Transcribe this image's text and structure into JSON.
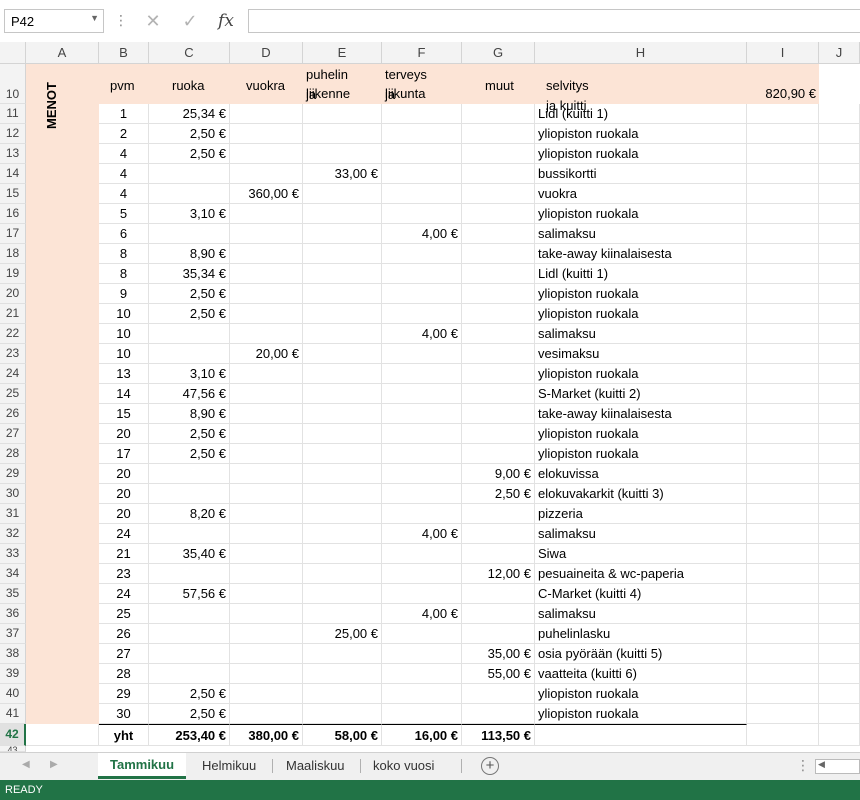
{
  "formula_bar": {
    "name_box": "P42",
    "fx_label": "fx",
    "formula": ""
  },
  "columns": [
    "A",
    "B",
    "C",
    "D",
    "E",
    "F",
    "G",
    "H",
    "I",
    "J"
  ],
  "header_row": {
    "row_number": "10",
    "side_label": "MENOT",
    "pvm": "pvm",
    "ruoka": "ruoka",
    "vuokra": "vuokra",
    "puhelin_line1": "puhelin ja",
    "puhelin_line2": "liikenne",
    "terveys_line1": "terveys ja",
    "terveys_line2": "liikunta",
    "muut": "muut",
    "selvitys": "selvitys ja kuitti",
    "total": "820,90 €"
  },
  "rows": [
    {
      "n": "11",
      "pvm": "1",
      "ruoka": "25,34 €",
      "vuokra": "",
      "puhelin": "",
      "terveys": "",
      "muut": "",
      "selvitys": "Lidl (kuitti 1)"
    },
    {
      "n": "12",
      "pvm": "2",
      "ruoka": "2,50 €",
      "vuokra": "",
      "puhelin": "",
      "terveys": "",
      "muut": "",
      "selvitys": "yliopiston ruokala"
    },
    {
      "n": "13",
      "pvm": "4",
      "ruoka": "2,50 €",
      "vuokra": "",
      "puhelin": "",
      "terveys": "",
      "muut": "",
      "selvitys": "yliopiston ruokala"
    },
    {
      "n": "14",
      "pvm": "4",
      "ruoka": "",
      "vuokra": "",
      "puhelin": "33,00 €",
      "terveys": "",
      "muut": "",
      "selvitys": "bussikortti"
    },
    {
      "n": "15",
      "pvm": "4",
      "ruoka": "",
      "vuokra": "360,00 €",
      "puhelin": "",
      "terveys": "",
      "muut": "",
      "selvitys": "vuokra"
    },
    {
      "n": "16",
      "pvm": "5",
      "ruoka": "3,10 €",
      "vuokra": "",
      "puhelin": "",
      "terveys": "",
      "muut": "",
      "selvitys": "yliopiston ruokala"
    },
    {
      "n": "17",
      "pvm": "6",
      "ruoka": "",
      "vuokra": "",
      "puhelin": "",
      "terveys": "4,00 €",
      "muut": "",
      "selvitys": "salimaksu"
    },
    {
      "n": "18",
      "pvm": "8",
      "ruoka": "8,90 €",
      "vuokra": "",
      "puhelin": "",
      "terveys": "",
      "muut": "",
      "selvitys": "take-away kiinalaisesta"
    },
    {
      "n": "19",
      "pvm": "8",
      "ruoka": "35,34 €",
      "vuokra": "",
      "puhelin": "",
      "terveys": "",
      "muut": "",
      "selvitys": "Lidl (kuitti 1)"
    },
    {
      "n": "20",
      "pvm": "9",
      "ruoka": "2,50 €",
      "vuokra": "",
      "puhelin": "",
      "terveys": "",
      "muut": "",
      "selvitys": "yliopiston ruokala"
    },
    {
      "n": "21",
      "pvm": "10",
      "ruoka": "2,50 €",
      "vuokra": "",
      "puhelin": "",
      "terveys": "",
      "muut": "",
      "selvitys": "yliopiston ruokala"
    },
    {
      "n": "22",
      "pvm": "10",
      "ruoka": "",
      "vuokra": "",
      "puhelin": "",
      "terveys": "4,00 €",
      "muut": "",
      "selvitys": "salimaksu"
    },
    {
      "n": "23",
      "pvm": "10",
      "ruoka": "",
      "vuokra": "20,00 €",
      "puhelin": "",
      "terveys": "",
      "muut": "",
      "selvitys": "vesimaksu"
    },
    {
      "n": "24",
      "pvm": "13",
      "ruoka": "3,10 €",
      "vuokra": "",
      "puhelin": "",
      "terveys": "",
      "muut": "",
      "selvitys": "yliopiston ruokala"
    },
    {
      "n": "25",
      "pvm": "14",
      "ruoka": "47,56 €",
      "vuokra": "",
      "puhelin": "",
      "terveys": "",
      "muut": "",
      "selvitys": "S-Market (kuitti 2)"
    },
    {
      "n": "26",
      "pvm": "15",
      "ruoka": "8,90 €",
      "vuokra": "",
      "puhelin": "",
      "terveys": "",
      "muut": "",
      "selvitys": "take-away kiinalaisesta"
    },
    {
      "n": "27",
      "pvm": "20",
      "ruoka": "2,50 €",
      "vuokra": "",
      "puhelin": "",
      "terveys": "",
      "muut": "",
      "selvitys": "yliopiston ruokala"
    },
    {
      "n": "28",
      "pvm": "17",
      "ruoka": "2,50 €",
      "vuokra": "",
      "puhelin": "",
      "terveys": "",
      "muut": "",
      "selvitys": "yliopiston ruokala"
    },
    {
      "n": "29",
      "pvm": "20",
      "ruoka": "",
      "vuokra": "",
      "puhelin": "",
      "terveys": "",
      "muut": "9,00 €",
      "selvitys": "elokuvissa"
    },
    {
      "n": "30",
      "pvm": "20",
      "ruoka": "",
      "vuokra": "",
      "puhelin": "",
      "terveys": "",
      "muut": "2,50 €",
      "selvitys": "elokuvakarkit (kuitti 3)"
    },
    {
      "n": "31",
      "pvm": "20",
      "ruoka": "8,20 €",
      "vuokra": "",
      "puhelin": "",
      "terveys": "",
      "muut": "",
      "selvitys": "pizzeria"
    },
    {
      "n": "32",
      "pvm": "24",
      "ruoka": "",
      "vuokra": "",
      "puhelin": "",
      "terveys": "4,00 €",
      "muut": "",
      "selvitys": "salimaksu"
    },
    {
      "n": "33",
      "pvm": "21",
      "ruoka": "35,40 €",
      "vuokra": "",
      "puhelin": "",
      "terveys": "",
      "muut": "",
      "selvitys": "Siwa"
    },
    {
      "n": "34",
      "pvm": "23",
      "ruoka": "",
      "vuokra": "",
      "puhelin": "",
      "terveys": "",
      "muut": "12,00 €",
      "selvitys": "pesuaineita & wc-paperia"
    },
    {
      "n": "35",
      "pvm": "24",
      "ruoka": "57,56 €",
      "vuokra": "",
      "puhelin": "",
      "terveys": "",
      "muut": "",
      "selvitys": "C-Market (kuitti 4)"
    },
    {
      "n": "36",
      "pvm": "25",
      "ruoka": "",
      "vuokra": "",
      "puhelin": "",
      "terveys": "4,00 €",
      "muut": "",
      "selvitys": "salimaksu"
    },
    {
      "n": "37",
      "pvm": "26",
      "ruoka": "",
      "vuokra": "",
      "puhelin": "25,00 €",
      "terveys": "",
      "muut": "",
      "selvitys": "puhelinlasku"
    },
    {
      "n": "38",
      "pvm": "27",
      "ruoka": "",
      "vuokra": "",
      "puhelin": "",
      "terveys": "",
      "muut": "35,00 €",
      "selvitys": "osia pyörään (kuitti 5)"
    },
    {
      "n": "39",
      "pvm": "28",
      "ruoka": "",
      "vuokra": "",
      "puhelin": "",
      "terveys": "",
      "muut": "55,00 €",
      "selvitys": "vaatteita (kuitti 6)"
    },
    {
      "n": "40",
      "pvm": "29",
      "ruoka": "2,50 €",
      "vuokra": "",
      "puhelin": "",
      "terveys": "",
      "muut": "",
      "selvitys": "yliopiston ruokala"
    },
    {
      "n": "41",
      "pvm": "30",
      "ruoka": "2,50 €",
      "vuokra": "",
      "puhelin": "",
      "terveys": "",
      "muut": "",
      "selvitys": "yliopiston ruokala"
    }
  ],
  "totals_row": {
    "n": "42",
    "label": "yht",
    "ruoka": "253,40 €",
    "vuokra": "380,00 €",
    "puhelin": "58,00 €",
    "terveys": "16,00 €",
    "muut": "113,50 €"
  },
  "partial_row": "43",
  "tabs": [
    "Tammikuu",
    "Helmikuu",
    "Maaliskuu",
    "koko vuosi"
  ],
  "active_tab": "Tammikuu",
  "status": "READY",
  "colors": {
    "accent": "#217346",
    "header_fill": "#fce4d6"
  }
}
